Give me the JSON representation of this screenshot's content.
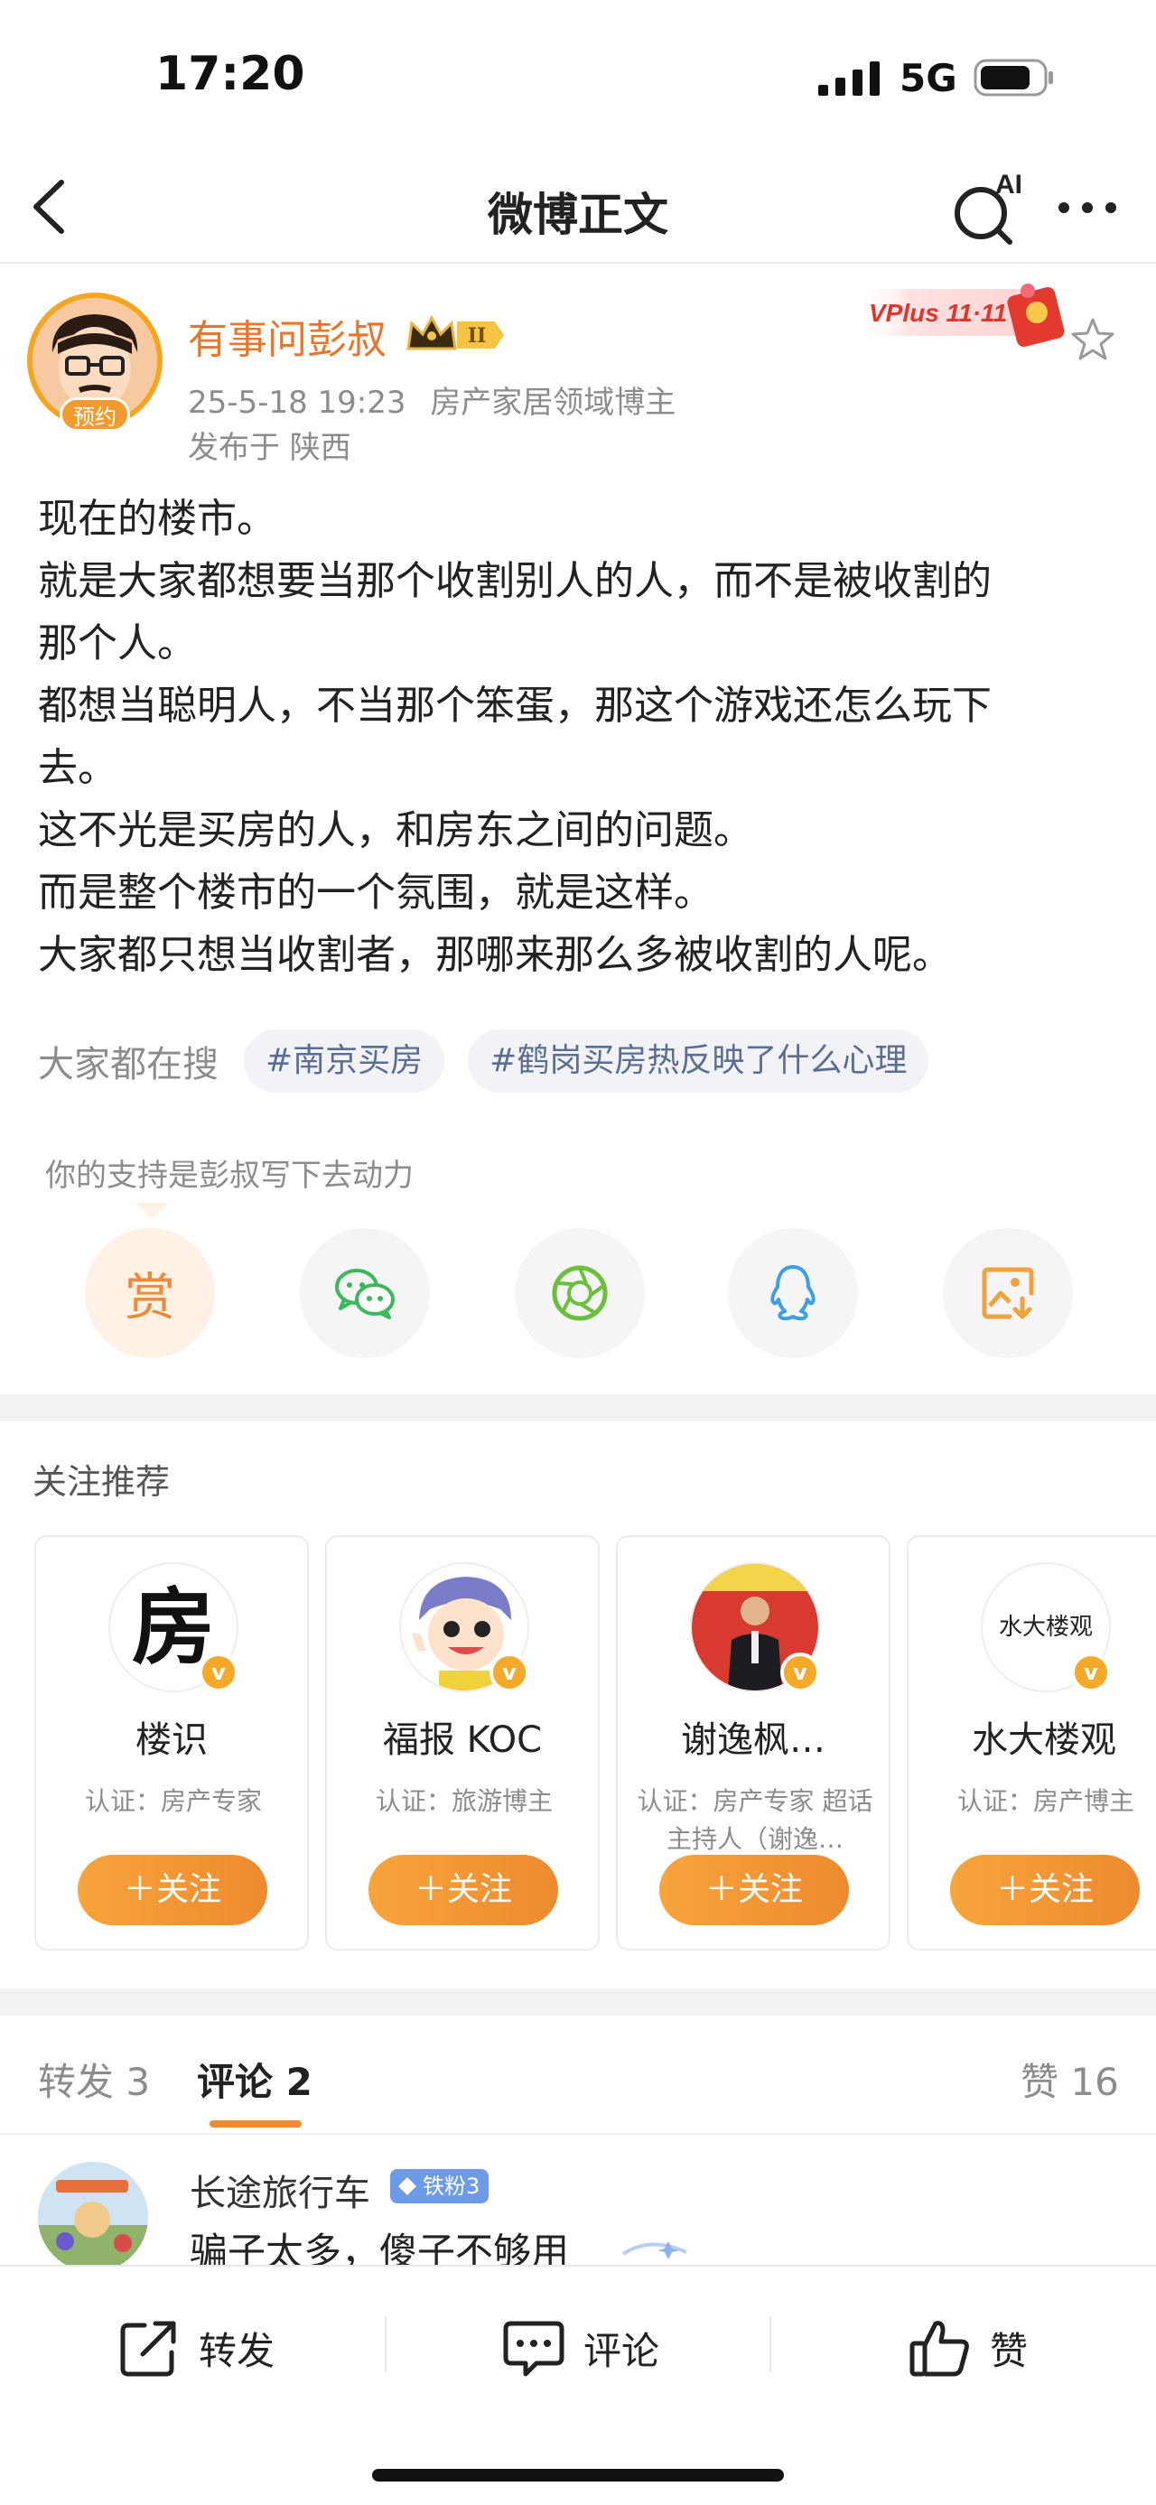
{
  "status_bar": {
    "time": "17:20",
    "network": "5G"
  },
  "nav": {
    "title": "微博正文",
    "ai_label": "AI"
  },
  "post": {
    "author": "有事问彭叔",
    "avatar_badge": "预约",
    "crown_level": "II",
    "timestamp": "25-5-18 19:23",
    "role": "房产家居领域博主",
    "location": "发布于 陕西",
    "vplus_label": "VPlus 11·11",
    "lines": [
      "现在的楼市。",
      "就是大家都想要当那个收割别人的人，而不是被收割的",
      "那个人。",
      "都想当聪明人，不当那个笨蛋，那这个游戏还怎么玩下",
      "去。",
      "这不光是买房的人，和房东之间的问题。",
      "而是整个楼市的一个氛围，就是这样。",
      "大家都只想当收割者，那哪来那么多被收割的人呢。"
    ]
  },
  "search": {
    "label": "大家都在搜",
    "tags": [
      "#南京买房",
      "#鹤岗买房热反映了什么心理"
    ]
  },
  "support": {
    "text": "你的支持是彭叔写下去动力",
    "reward_label": "赏"
  },
  "recommend": {
    "title": "关注推荐",
    "cards": [
      {
        "name": "楼识",
        "desc": "认证：房产专家",
        "avatar_glyph": "房",
        "follow": "＋关注"
      },
      {
        "name": "福报 KOC",
        "desc": "认证：旅游博主",
        "follow": "＋关注"
      },
      {
        "name": "谢逸枫…",
        "desc": "认证：房产专家 超话主持人（谢逸…",
        "follow": "＋关注"
      },
      {
        "name": "水大楼观",
        "desc": "认证：房产博主",
        "avatar_glyph": "水大楼观",
        "follow": "＋关注"
      }
    ]
  },
  "tabs": {
    "repost": "转发 3",
    "comment": "评论 2",
    "like": "赞 16"
  },
  "comment": {
    "name": "长途旅行车",
    "fan_badge": "铁粉3",
    "text": "骗子太多，傻子不够用"
  },
  "bottom_bar": {
    "repost": "转发",
    "comment": "评论",
    "like": "赞"
  },
  "colors": {
    "accent": "#ee8a2f",
    "author": "#e9752a",
    "tag_text": "#5b6d92",
    "fan_badge": "#6d9be8"
  }
}
